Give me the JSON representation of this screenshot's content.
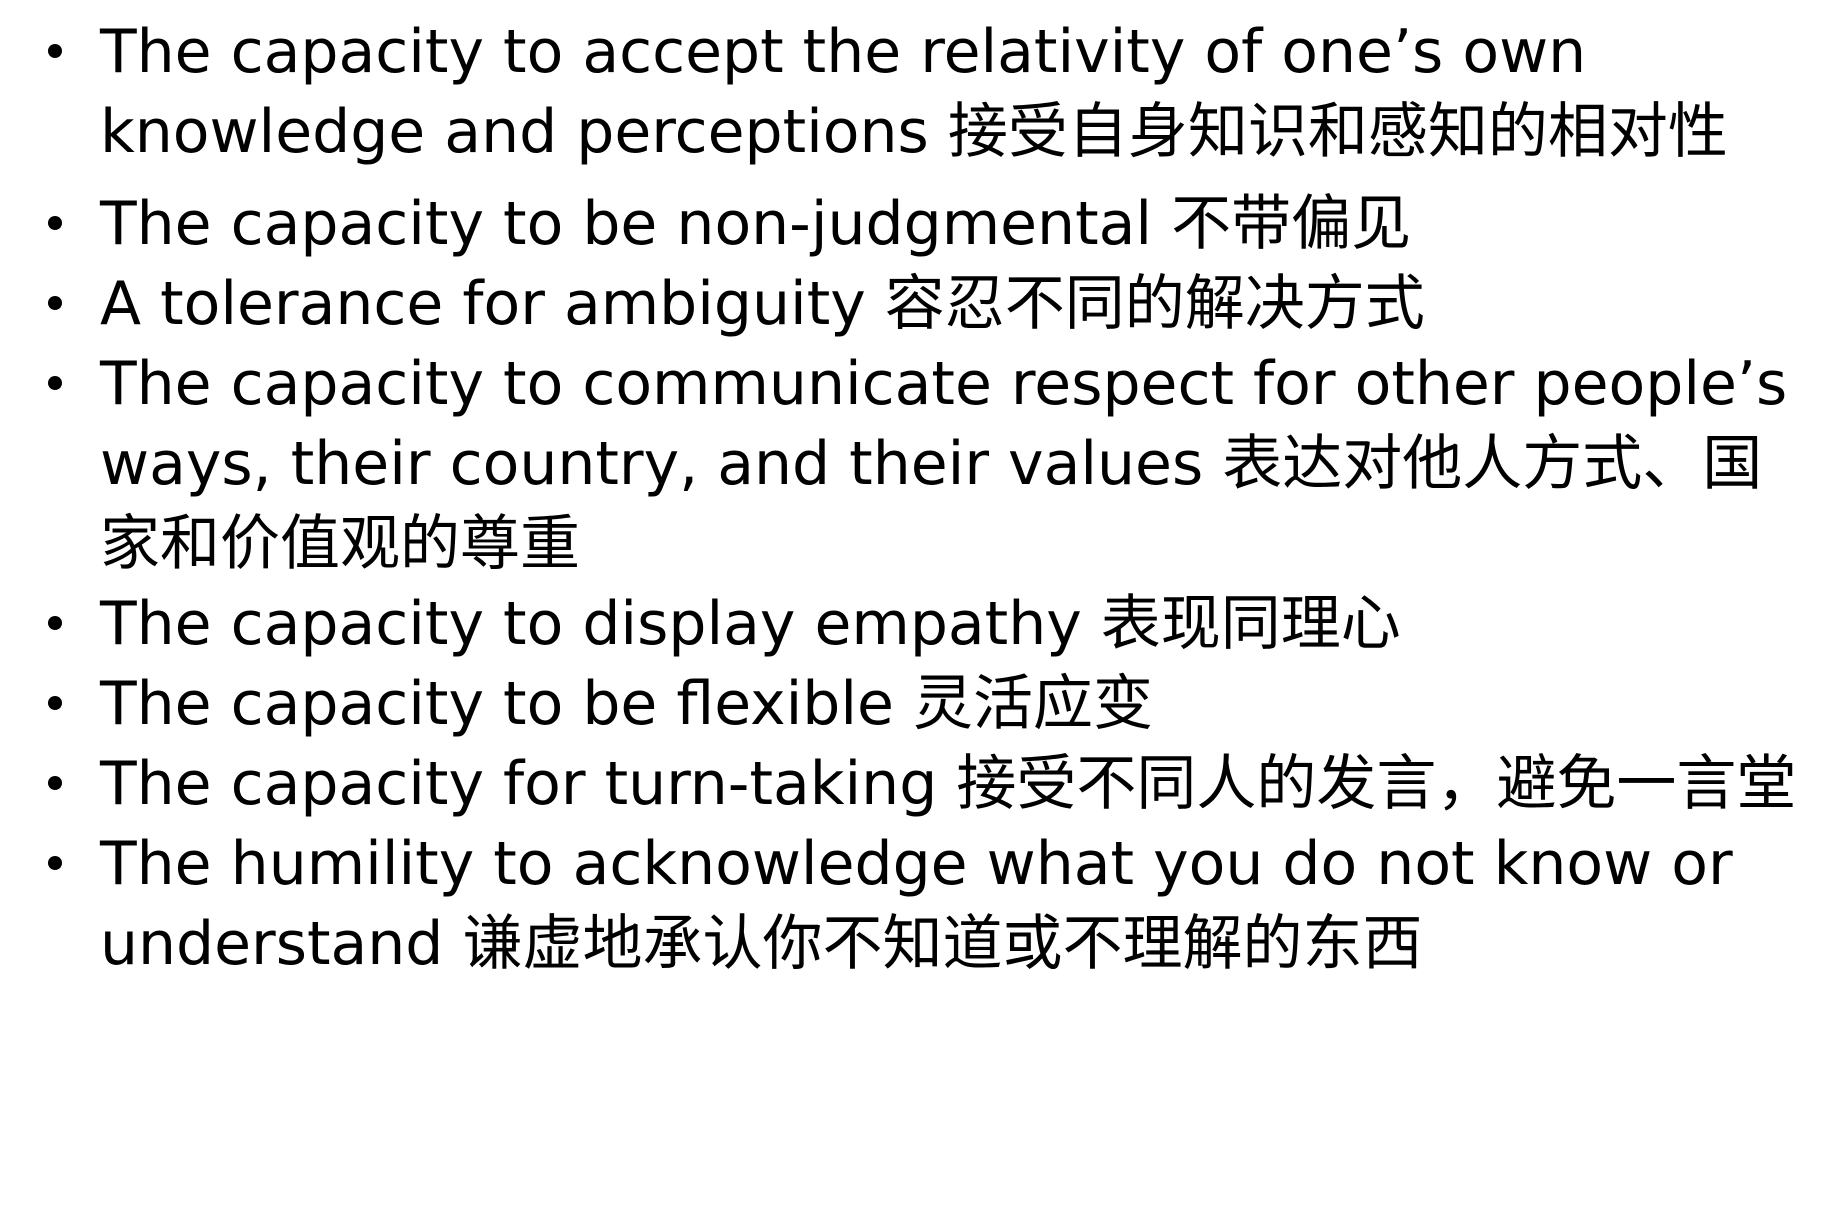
{
  "bullets": [
    {
      "text": "The capacity to accept the relativity of one’s own knowledge and perceptions  接受自身知识和感知的相对性"
    },
    {
      "text": "The capacity to be non-judgmental 不带偏见"
    },
    {
      "text": "A tolerance for ambiguity 容忍不同的解决方式"
    },
    {
      "text": "The capacity to communicate respect for other people’s ways, their country, and their values 表达对他人方式、国家和价值观的尊重"
    },
    {
      "text": "The capacity to display empathy 表现同理心"
    },
    {
      "text": "The capacity to be flexible 灵活应变"
    },
    {
      "text": "The capacity for turn-taking 接受不同人的发言，避免一言堂"
    },
    {
      "text": "The humility to acknowledge what you do not know or understand  谦虚地承认你不知道或不理解的东西"
    }
  ]
}
